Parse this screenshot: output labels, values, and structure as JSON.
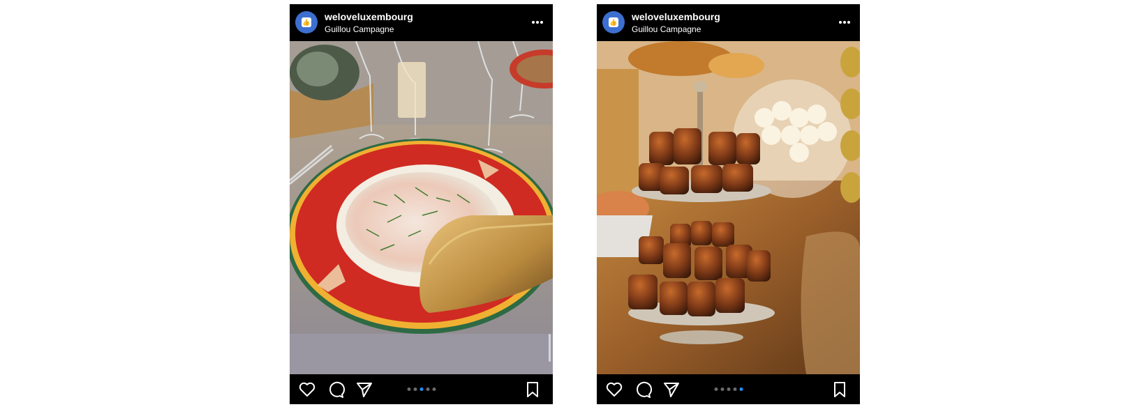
{
  "posts": [
    {
      "username": "weloveluxembourg",
      "location": "Guillou Campagne",
      "carousel": {
        "total": 5,
        "active_index": 2
      },
      "photo_subject": "salmon-pasta-with-toast"
    },
    {
      "username": "weloveluxembourg",
      "location": "Guillou Campagne",
      "carousel": {
        "total": 5,
        "active_index": 4
      },
      "photo_subject": "caneles-on-tiered-stand"
    }
  ],
  "icons": {
    "more": "more-options-icon",
    "like": "heart-icon",
    "comment": "comment-icon",
    "share": "share-icon",
    "save": "bookmark-icon"
  },
  "colors": {
    "background": "#ffffff",
    "post_chrome": "#000000",
    "active_dot": "#1e90ff",
    "avatar": "#3d6fd0"
  }
}
